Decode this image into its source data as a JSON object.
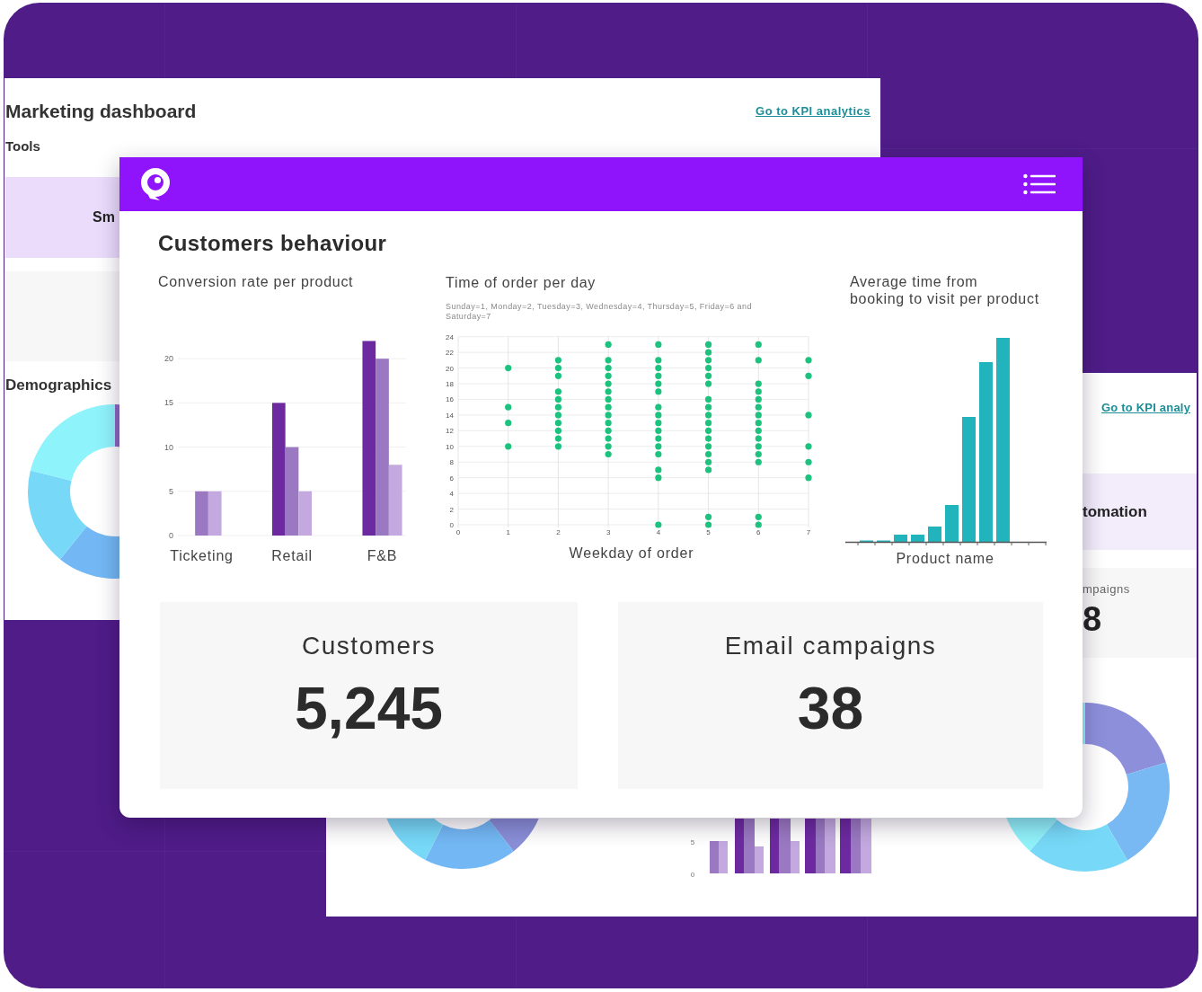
{
  "back_window_left": {
    "title": "Marketing dashboard",
    "link": "Go to KPI analytics",
    "section": "Tools",
    "tile_label": "Sm",
    "demographics_heading": "Demographics"
  },
  "back_window_right": {
    "link": "Go to KPI analy",
    "tile_label": "tomation",
    "stat_label": "mpaigns",
    "stat_value": "8",
    "mini_chart_ticks": [
      "5",
      "0"
    ]
  },
  "front_window": {
    "title": "Customers behaviour",
    "conversion_chart": {
      "chart_data": {
        "type": "bar",
        "title": "Conversion rate per product",
        "categories": [
          "Ticketing",
          "Retail",
          "F&B"
        ],
        "series": [
          {
            "color": "#6d2aa0",
            "values": [
              0,
              15,
              22
            ]
          },
          {
            "color": "#9a79c2",
            "values": [
              5,
              10,
              20
            ]
          },
          {
            "color": "#c3a9df",
            "values": [
              5,
              5,
              8
            ]
          }
        ],
        "ylim": [
          0,
          22
        ],
        "yticks": [
          0,
          5,
          10,
          15,
          20
        ],
        "grid": true
      }
    },
    "order_time_chart": {
      "subtitle": "Sunday=1, Monday=2, Tuesday=3, Wednesday=4, Thursday=5, Friday=6 and Saturday=7",
      "chart_data": {
        "type": "scatter",
        "title": "Time of order per day",
        "xlabel": "Weekday of order",
        "x": [
          1,
          1,
          1,
          1,
          2,
          2,
          2,
          2,
          2,
          2,
          2,
          2,
          2,
          2,
          2,
          3,
          3,
          3,
          3,
          3,
          3,
          3,
          3,
          3,
          3,
          3,
          3,
          3,
          3,
          4,
          4,
          4,
          4,
          4,
          4,
          4,
          4,
          4,
          4,
          4,
          4,
          4,
          4,
          4,
          4,
          5,
          5,
          5,
          5,
          5,
          5,
          5,
          5,
          5,
          5,
          5,
          5,
          5,
          5,
          5,
          5,
          5,
          5,
          6,
          6,
          6,
          6,
          6,
          6,
          6,
          6,
          6,
          6,
          6,
          6,
          6,
          6,
          6,
          7,
          7,
          7,
          7,
          7,
          7
        ],
        "series": [
          {
            "color": "#1dc27e",
            "values": [
              20,
              15,
              13,
              10,
              21,
              20,
              19,
              17,
              16,
              15,
              14,
              13,
              12,
              11,
              10,
              23,
              21,
              20,
              19,
              18,
              17,
              16,
              15,
              14,
              13,
              12,
              11,
              10,
              9,
              23,
              21,
              20,
              19,
              18,
              17,
              15,
              14,
              13,
              12,
              11,
              10,
              9,
              7,
              6,
              0,
              23,
              22,
              21,
              20,
              19,
              18,
              16,
              15,
              14,
              13,
              12,
              11,
              10,
              9,
              8,
              7,
              1,
              0,
              23,
              21,
              18,
              17,
              16,
              15,
              14,
              13,
              12,
              11,
              10,
              9,
              8,
              1,
              0,
              21,
              19,
              14,
              10,
              8,
              6
            ]
          }
        ],
        "xlim": [
          0,
          7
        ],
        "ylim": [
          0,
          24
        ],
        "xticks": [
          0,
          1,
          2,
          3,
          4,
          5,
          6,
          7
        ],
        "yticks": [
          0,
          2,
          4,
          6,
          8,
          10,
          12,
          14,
          16,
          18,
          20,
          22,
          24
        ],
        "grid": true
      }
    },
    "booking_chart": {
      "title": "Average time from\nbooking to visit per product",
      "xlabel": "Product name"
    },
    "stats": [
      {
        "label": "Customers",
        "value": "5,245"
      },
      {
        "label": "Email campaigns",
        "value": "38"
      }
    ]
  }
}
